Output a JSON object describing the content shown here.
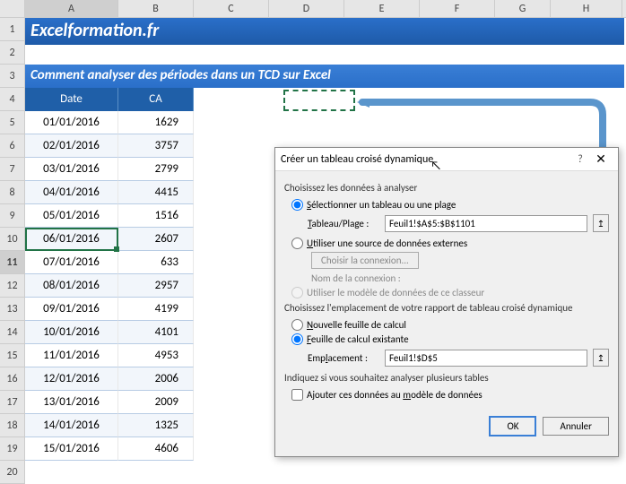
{
  "columns": [
    "A",
    "B",
    "C",
    "D",
    "E",
    "F",
    "G",
    "H"
  ],
  "rowNumbers": [
    "1",
    "2",
    "3",
    "4",
    "5",
    "6",
    "7",
    "8",
    "9",
    "10",
    "11",
    "12",
    "13",
    "14",
    "15",
    "16",
    "17",
    "18",
    "19",
    "20"
  ],
  "banner1": "Excelformation.fr",
  "banner2": "Comment analyser des périodes dans un TCD sur Excel",
  "headers": {
    "date": "Date",
    "ca": "CA"
  },
  "table": [
    {
      "date": "01/01/2016",
      "ca": "1629"
    },
    {
      "date": "02/01/2016",
      "ca": "3757"
    },
    {
      "date": "03/01/2016",
      "ca": "2799"
    },
    {
      "date": "04/01/2016",
      "ca": "4415"
    },
    {
      "date": "05/01/2016",
      "ca": "1516"
    },
    {
      "date": "06/01/2016",
      "ca": "2607"
    },
    {
      "date": "07/01/2016",
      "ca": "633"
    },
    {
      "date": "08/01/2016",
      "ca": "2957"
    },
    {
      "date": "09/01/2016",
      "ca": "4199"
    },
    {
      "date": "10/01/2016",
      "ca": "4101"
    },
    {
      "date": "11/01/2016",
      "ca": "4953"
    },
    {
      "date": "12/01/2016",
      "ca": "2006"
    },
    {
      "date": "13/01/2016",
      "ca": "2009"
    },
    {
      "date": "14/01/2016",
      "ca": "1325"
    },
    {
      "date": "15/01/2016",
      "ca": "4606"
    }
  ],
  "dialog": {
    "title": "Créer un tableau croisé dynamique",
    "help": "?",
    "close": "✕",
    "section1": "Choisissez les données à analyser",
    "opt_select": "Sélectionner un tableau ou une plage",
    "table_range_label": "Tableau/Plage :",
    "table_range_value": "Feuil1!$A$5:$B$1101",
    "opt_external": "Utiliser une source de données externes",
    "choose_conn": "Choisir la connexion...",
    "conn_name": "Nom de la connexion :",
    "opt_model": "Utiliser le modèle de données de ce classeur",
    "section2": "Choisissez l'emplacement de votre rapport de tableau croisé dynamique",
    "opt_newsheet": "Nouvelle feuille de calcul",
    "opt_existing": "Feuille de calcul existante",
    "loc_label": "Emplacement :",
    "loc_value": "Feuil1!$D$5",
    "section3": "Indiquez si vous souhaitez analyser plusieurs tables",
    "chk_model": "Ajouter ces données au modèle de données",
    "ok": "OK",
    "cancel": "Annuler",
    "range_icon": "↥"
  }
}
